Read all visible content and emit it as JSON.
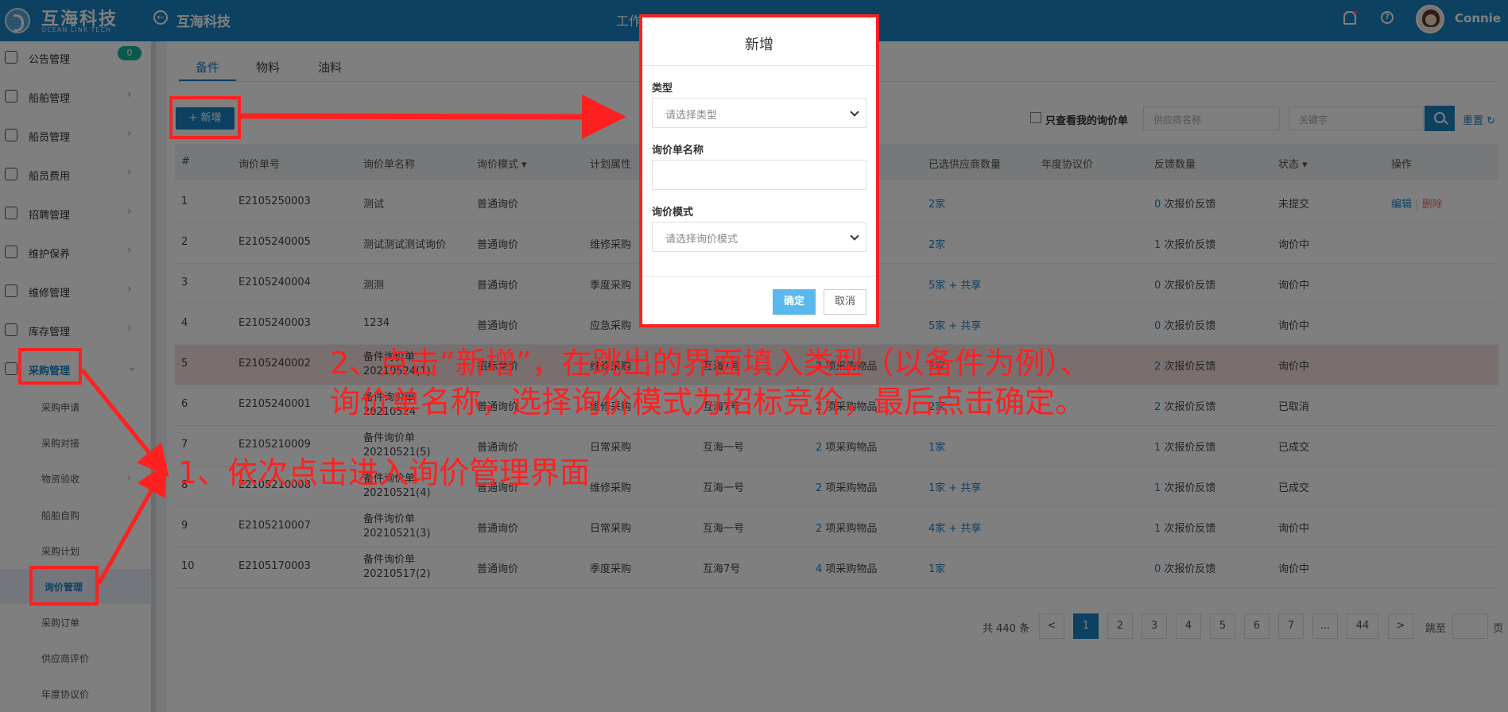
{
  "header": {
    "logo_title": "互海科技",
    "logo_sub": "OCEAN LINK TECH",
    "title": "互海科技",
    "nav": [
      "工作台",
      "",
      "",
      ""
    ],
    "user_name": "Connie"
  },
  "sidebar": {
    "badge": "0",
    "items": [
      {
        "label": "公告管理"
      },
      {
        "label": "船舶管理"
      },
      {
        "label": "船员管理"
      },
      {
        "label": "船员费用"
      },
      {
        "label": "招聘管理"
      },
      {
        "label": "维护保养"
      },
      {
        "label": "维修管理"
      },
      {
        "label": "库存管理"
      },
      {
        "label": "采购管理"
      }
    ],
    "sub_items": [
      {
        "label": "采购申请"
      },
      {
        "label": "采购对接"
      },
      {
        "label": "物资验收"
      },
      {
        "label": "船舶自购"
      },
      {
        "label": "采购计划"
      },
      {
        "label": "询价管理"
      },
      {
        "label": "采购订单"
      },
      {
        "label": "供应商评价"
      },
      {
        "label": "年度协议价"
      }
    ]
  },
  "tabs": [
    {
      "label": "备件"
    },
    {
      "label": "物料"
    },
    {
      "label": "油料"
    }
  ],
  "toolbar": {
    "add_label": "+ 新增",
    "only_mine_label": "只查看我的询价单",
    "supplier_placeholder": "供应商名称",
    "keyword_placeholder": "关键字",
    "reset_label": "重置"
  },
  "table": {
    "headers": [
      "#",
      "询价单号",
      "询价单名称",
      "询价模式 ▾",
      "计划属性",
      "",
      "",
      "已选供应商数量",
      "年度协议价",
      "反馈数量",
      "状态 ▾",
      "操作"
    ],
    "rows": [
      {
        "n": "1",
        "no": "E2105250003",
        "name": "测试",
        "mode": "普通询价",
        "plan": "",
        "ship": "",
        "items": "",
        "sup": "2家",
        "fb_n": "0",
        "fb": " 次报价反馈",
        "status": "未提交",
        "edit": "编辑",
        "del": "删除"
      },
      {
        "n": "2",
        "no": "E2105240005",
        "name": "测试测试测试询价",
        "mode": "普通询价",
        "plan": "维修采购",
        "ship": "",
        "items": "",
        "sup": "2家",
        "fb_n": "1",
        "fb": " 次报价反馈",
        "status": "询价中"
      },
      {
        "n": "3",
        "no": "E2105240004",
        "name": "测测",
        "mode": "普通询价",
        "plan": "季度采购",
        "ship": "",
        "items": "",
        "sup": "5家 + 共享",
        "fb_n": "0",
        "fb": " 次报价反馈",
        "status": "询价中"
      },
      {
        "n": "4",
        "no": "E2105240003",
        "name": "1234",
        "mode": "普通询价",
        "plan": "应急采购",
        "ship": "",
        "items": "",
        "sup": "5家 + 共享",
        "fb_n": "0",
        "fb": " 次报价反馈",
        "status": "询价中"
      },
      {
        "n": "5",
        "no": "E2105240002",
        "name": "备件询价单20210524(1)",
        "mode": "招标竞价",
        "plan": "维修采购",
        "ship": "互海7号",
        "items": "项采购物品",
        "items_n": "2",
        "sup": "2家",
        "fb_n": "2",
        "fb": " 次报价反馈",
        "status": "询价中"
      },
      {
        "n": "6",
        "no": "E2105240001",
        "name": "备件询价单20210524",
        "mode": "普通询价",
        "plan": "维修采购",
        "ship": "互海7号",
        "items": "项采购物品",
        "items_n": "2",
        "sup": "2家",
        "fb_n": "2",
        "fb": " 次报价反馈",
        "status": "已取消"
      },
      {
        "n": "7",
        "no": "E2105210009",
        "name": "备件询价单20210521(5)",
        "mode": "普通询价",
        "plan": "日常采购",
        "ship": "互海一号",
        "items": "项采购物品",
        "items_n": "2",
        "sup": "1家",
        "fb_n": "1",
        "fb": " 次报价反馈",
        "status": "已成交"
      },
      {
        "n": "8",
        "no": "E2105210008",
        "name": "备件询价单20210521(4)",
        "mode": "普通询价",
        "plan": "维修采购",
        "ship": "互海一号",
        "items": "项采购物品",
        "items_n": "2",
        "sup": "1家 + 共享",
        "fb_n": "1",
        "fb": " 次报价反馈",
        "status": "已成交"
      },
      {
        "n": "9",
        "no": "E2105210007",
        "name": "备件询价单20210521(3)",
        "mode": "普通询价",
        "plan": "日常采购",
        "ship": "互海一号",
        "items": "项采购物品",
        "items_n": "2",
        "sup": "4家 + 共享",
        "fb_n": "1",
        "fb": " 次报价反馈",
        "status": "询价中"
      },
      {
        "n": "10",
        "no": "E2105170003",
        "name": "备件询价单20210517(2)",
        "mode": "普通询价",
        "plan": "季度采购",
        "ship": "互海7号",
        "items": "项采购物品",
        "items_n": "4",
        "sup": "1家",
        "fb_n": "0",
        "fb": " 次报价反馈",
        "status": "询价中"
      }
    ]
  },
  "pagination": {
    "total": "共 440 条",
    "prev": "<",
    "pages": [
      "1",
      "2",
      "3",
      "4",
      "5",
      "6",
      "7",
      "...",
      "44"
    ],
    "next": ">",
    "goto_label": "跳至",
    "unit": "页"
  },
  "modal": {
    "title": "新增",
    "type_label": "类型",
    "type_placeholder": "请选择类型",
    "name_label": "询价单名称",
    "mode_label": "询价模式",
    "mode_placeholder": "请选择询价模式",
    "ok_label": "确定",
    "cancel_label": "取消"
  },
  "annotations": {
    "step1": "1、依次点击进入询价管理界面",
    "step2_line1": "2、点击“新增”，在跳出的界面填入类型（以备件为例）、",
    "step2_line2": "询价单名称，选择询价模式为招标竞价，最后点击确定。",
    "color": "#ff2020"
  }
}
